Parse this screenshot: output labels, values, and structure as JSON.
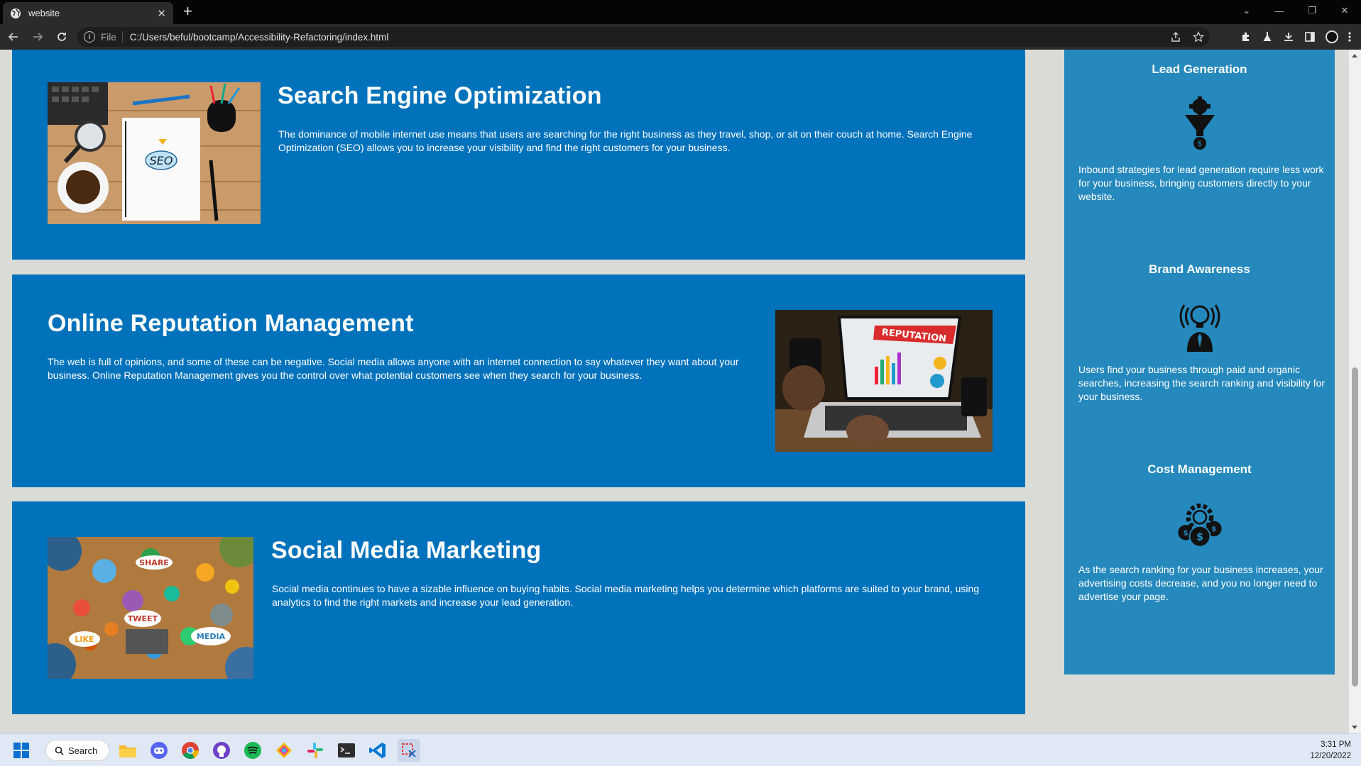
{
  "browser": {
    "tab_title": "website",
    "new_tab": "+",
    "url_scheme_label": "File",
    "url": "C:/Users/beful/bootcamp/Accessibility-Refactoring/index.html"
  },
  "services": [
    {
      "title": "Search Engine Optimization",
      "text": "The dominance of mobile internet use means that users are searching for the right business as they travel, shop, or sit on their couch at home. Search Engine Optimization (SEO) allows you to increase your visibility and find the right customers for your business.",
      "image_label": "SEO"
    },
    {
      "title": "Online Reputation Management",
      "text": "The web is full of opinions, and some of these can be negative. Social media allows anyone with an internet connection to say whatever they want about your business. Online Reputation Management gives you the control over what potential customers see when they search for your business.",
      "image_label": "REPUTATION"
    },
    {
      "title": "Social Media Marketing",
      "text": "Social media continues to have a sizable influence on buying habits. Social media marketing helps you determine which platforms are suited to your brand, using analytics to find the right markets and increase your lead generation.",
      "image_labels": [
        "SHARE",
        "TWEET",
        "LIKE",
        "MEDIA"
      ]
    }
  ],
  "benefits": [
    {
      "title": "Lead Generation",
      "icon": "funnel-gear-icon",
      "text": "Inbound strategies for lead generation require less work for your business, bringing customers directly to your website."
    },
    {
      "title": "Brand Awareness",
      "icon": "lightbulb-person-icon",
      "text": "Users find your business through paid and organic searches, increasing the search ranking and visibility for your business."
    },
    {
      "title": "Cost Management",
      "icon": "gear-coins-icon",
      "text": "As the search ranking for your business increases, your advertising costs decrease, and you no longer need to advertise your page."
    }
  ],
  "taskbar": {
    "search_label": "Search",
    "time": "3:31 PM",
    "date": "12/20/2022"
  },
  "colors": {
    "card_blue": "#0072bb",
    "aside_blue": "#2589bd",
    "page_bg": "#d9dcd6"
  }
}
